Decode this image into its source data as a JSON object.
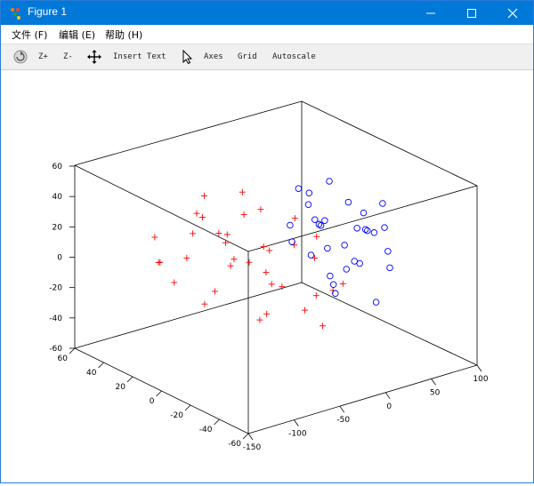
{
  "window": {
    "title": "Figure 1"
  },
  "menu": [
    {
      "label": "文件 (F)"
    },
    {
      "label": "编辑 (E)"
    },
    {
      "label": "帮助 (H)"
    }
  ],
  "toolbar": {
    "zoom_in": "Z+",
    "zoom_out": "Z-",
    "insert_text": "Insert Text",
    "axes": "Axes",
    "grid": "Grid",
    "autoscale": "Autoscale"
  },
  "colors": {
    "titlebar": "#0078d7",
    "series_plus": "#ff0000",
    "series_circle": "#0000ff"
  },
  "chart_data": {
    "type": "scatter",
    "dimensions": 3,
    "xlim": [
      -150,
      100
    ],
    "ylim": [
      -60,
      60
    ],
    "zlim": [
      -60,
      60
    ],
    "x_ticks": [
      "-150",
      "-100",
      "-50",
      "0",
      "50",
      "100"
    ],
    "y_ticks": [
      "-60",
      "-40",
      "-20",
      "0",
      "20",
      "40",
      "60"
    ],
    "z_ticks": [
      "-60",
      "-40",
      "-20",
      "0",
      "20",
      "40",
      "60"
    ],
    "grid": false,
    "series": [
      {
        "marker": "plus",
        "color": "#ff0000",
        "points": [
          [
            -110,
            30,
            20
          ],
          [
            -120,
            20,
            10
          ],
          [
            -90,
            40,
            -5
          ],
          [
            -100,
            10,
            30
          ],
          [
            -80,
            0,
            25
          ],
          [
            -70,
            -10,
            15
          ],
          [
            -60,
            20,
            -20
          ],
          [
            -50,
            -20,
            0
          ],
          [
            -40,
            30,
            10
          ],
          [
            -30,
            -30,
            20
          ],
          [
            -20,
            10,
            -10
          ],
          [
            -15,
            -40,
            5
          ],
          [
            -60,
            -50,
            10
          ],
          [
            -90,
            -30,
            -10
          ],
          [
            -40,
            40,
            30
          ],
          [
            -20,
            -10,
            35
          ],
          [
            -10,
            20,
            25
          ],
          [
            -35,
            0,
            -30
          ],
          [
            -55,
            10,
            5
          ],
          [
            -75,
            30,
            0
          ],
          [
            -25,
            -20,
            -20
          ],
          [
            -45,
            -45,
            -15
          ],
          [
            -65,
            45,
            -25
          ],
          [
            -85,
            -35,
            15
          ],
          [
            -5,
            0,
            10
          ],
          [
            -30,
            20,
            40
          ],
          [
            -10,
            -30,
            -5
          ],
          [
            -50,
            35,
            20
          ],
          [
            -70,
            -20,
            30
          ],
          [
            -95,
            5,
            -15
          ],
          [
            -15,
            40,
            0
          ],
          [
            -40,
            -5,
            15
          ],
          [
            -60,
            0,
            40
          ],
          [
            -80,
            20,
            35
          ],
          [
            -20,
            -25,
            30
          ],
          [
            -35,
            25,
            -10
          ]
        ]
      },
      {
        "marker": "circle",
        "color": "#0000ff",
        "points": [
          [
            40,
            10,
            10
          ],
          [
            50,
            0,
            0
          ],
          [
            60,
            20,
            5
          ],
          [
            45,
            -10,
            -5
          ],
          [
            30,
            5,
            15
          ],
          [
            55,
            15,
            -10
          ],
          [
            65,
            -5,
            10
          ],
          [
            35,
            -20,
            0
          ],
          [
            70,
            10,
            20
          ],
          [
            50,
            25,
            15
          ],
          [
            40,
            -15,
            20
          ],
          [
            60,
            -25,
            -5
          ],
          [
            45,
            20,
            -15
          ],
          [
            30,
            -5,
            -20
          ],
          [
            55,
            -10,
            25
          ],
          [
            75,
            0,
            5
          ],
          [
            35,
            15,
            30
          ],
          [
            65,
            30,
            0
          ],
          [
            50,
            -30,
            10
          ],
          [
            40,
            30,
            -10
          ],
          [
            60,
            5,
            -20
          ],
          [
            45,
            -25,
            -25
          ],
          [
            70,
            -15,
            15
          ],
          [
            30,
            25,
            5
          ],
          [
            55,
            35,
            20
          ],
          [
            40,
            0,
            -30
          ],
          [
            65,
            20,
            30
          ],
          [
            50,
            10,
            -25
          ],
          [
            35,
            -30,
            25
          ],
          [
            60,
            -20,
            35
          ]
        ]
      }
    ]
  }
}
